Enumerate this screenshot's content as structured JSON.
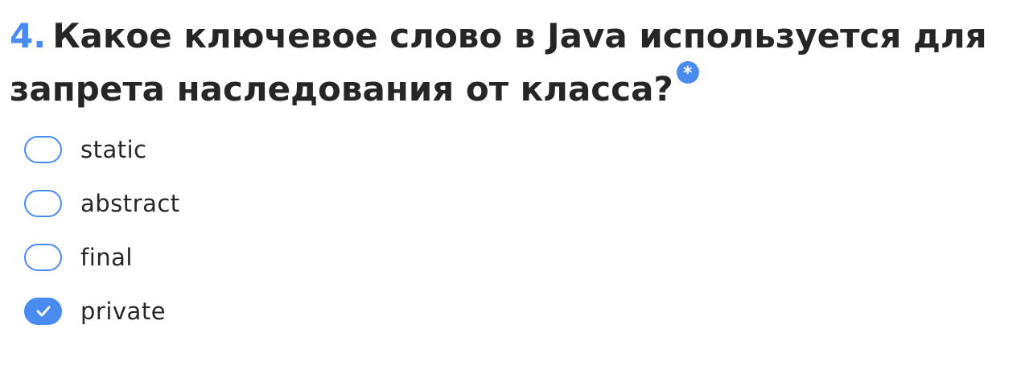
{
  "question": {
    "number": "4.",
    "text": "Какое ключевое слово в Java используется для запрета наследования от класса?",
    "required_mark": "*"
  },
  "options": [
    {
      "label": "static",
      "checked": false
    },
    {
      "label": "abstract",
      "checked": false
    },
    {
      "label": "final",
      "checked": false
    },
    {
      "label": "private",
      "checked": true
    }
  ],
  "colors": {
    "accent": "#4a8bf0",
    "text": "#262626",
    "background": "#ffffff"
  },
  "icons": {
    "required": "asterisk-badge-icon",
    "check": "checkmark-icon"
  }
}
